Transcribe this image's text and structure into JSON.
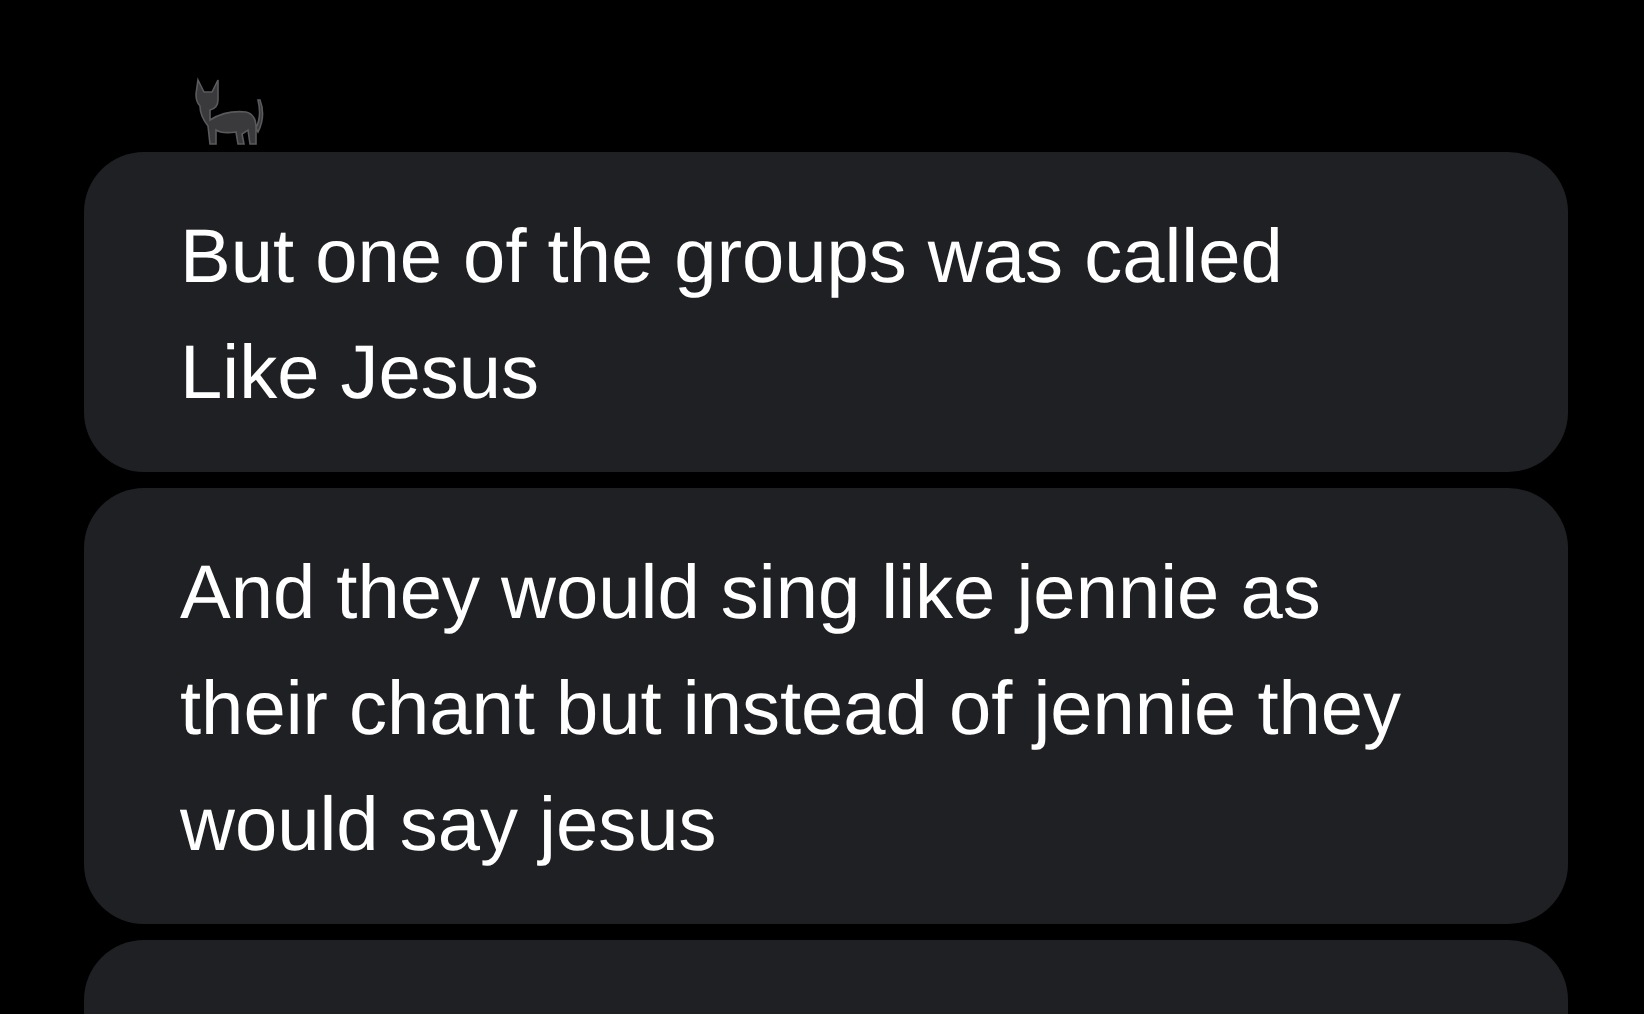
{
  "messages": [
    {
      "text": "But one of the groups was called Like Jesus"
    },
    {
      "text": "And they would sing like jennie as their chant but instead of jennie they would say jesus"
    }
  ]
}
